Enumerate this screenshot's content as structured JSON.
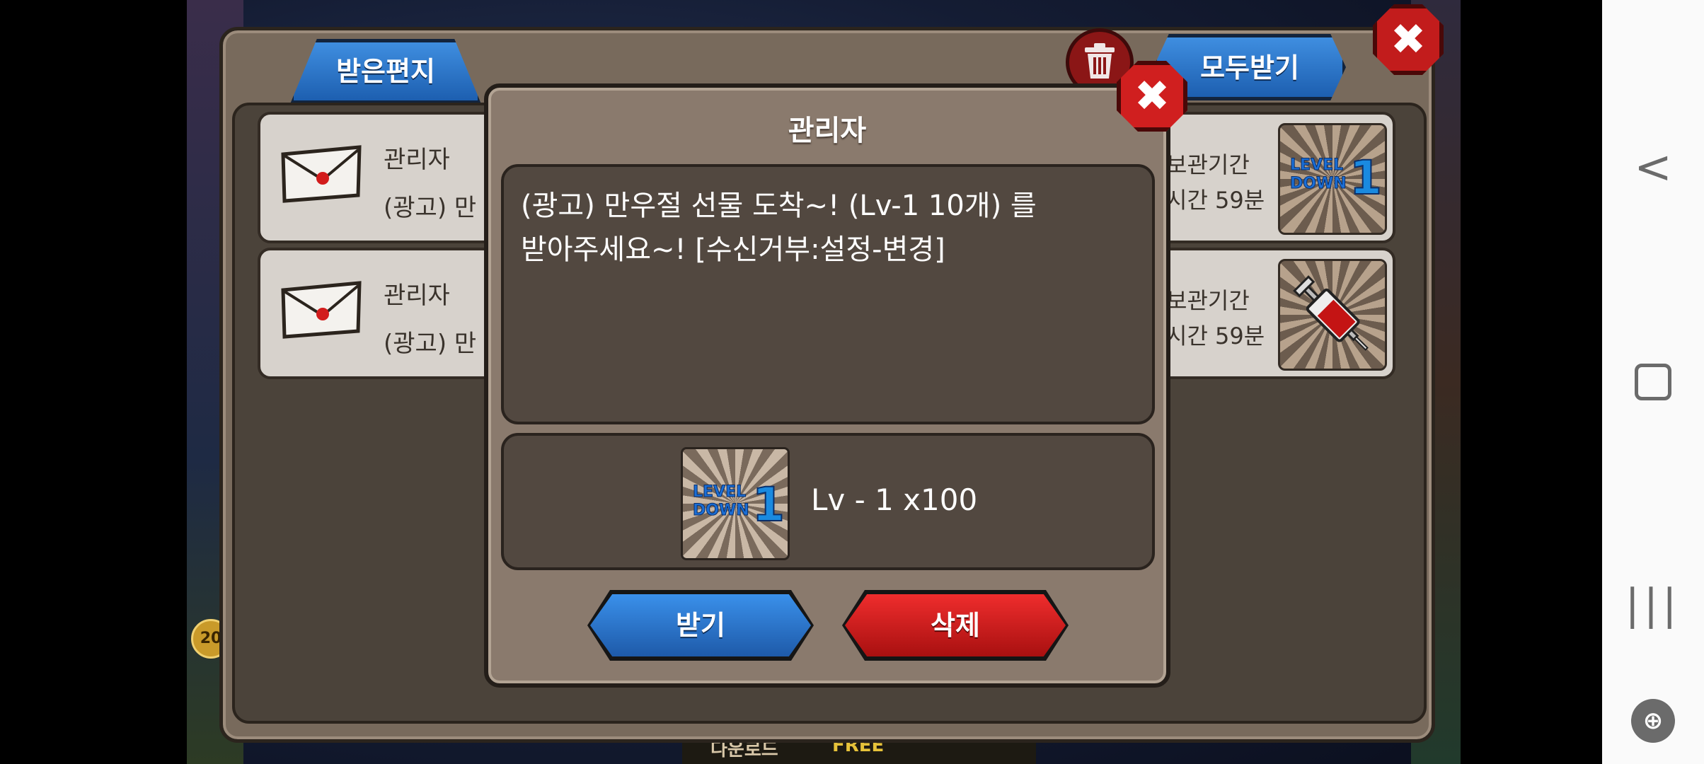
{
  "inbox": {
    "tab_received": "받은편지",
    "receive_all_label": "모두받기",
    "mails": [
      {
        "sender": "관리자",
        "subject_preview": "(광고) 만",
        "keep_label": "보관기간",
        "time_left": "시간 59분",
        "item_icon": "level-down-icon"
      },
      {
        "sender": "관리자",
        "subject_preview": "(광고) 만",
        "keep_label": "보관기간",
        "time_left": "시간 59분",
        "item_icon": "syringe-icon"
      }
    ]
  },
  "background": {
    "coin_value": "20",
    "bottom_text_1": "다운로드",
    "bottom_text_2": "FREE"
  },
  "dialog": {
    "title": "관리자",
    "message": "(광고) 만우절 선물 도착~! (Lv-1 10개) 를\n받아주세요~! [수신거부:설정-변경]",
    "reward_text": "Lv - 1 x100",
    "reward_icon": "level-down-icon",
    "receive_label": "받기",
    "delete_label": "삭제"
  },
  "badge": {
    "level": "LEVEL",
    "down": "DOWN",
    "number": "1"
  },
  "android_nav": {
    "back": "<",
    "recents": "|||",
    "game_tools": "⊕"
  },
  "colors": {
    "blue_button": "#1e5aa9",
    "red_button": "#a81010",
    "panel": "#786a5c"
  }
}
